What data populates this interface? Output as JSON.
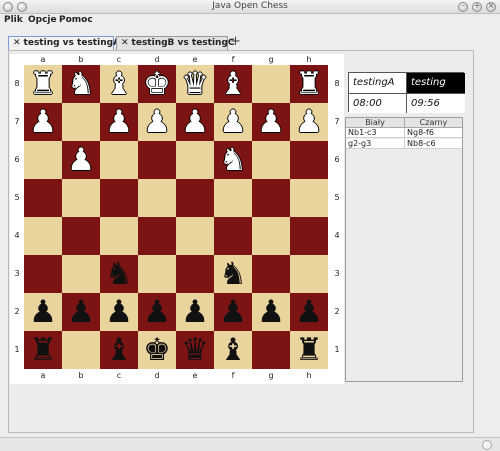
{
  "window": {
    "title": "Java Open Chess"
  },
  "menu": [
    "Plik",
    "Opcje",
    "Pomoc"
  ],
  "tabs": [
    {
      "label": "testing vs testingA",
      "active": true
    },
    {
      "label": "testingB vs testingC",
      "active": false
    }
  ],
  "new_tab_label": "+",
  "board": {
    "files": [
      "a",
      "b",
      "c",
      "d",
      "e",
      "f",
      "g",
      "h"
    ],
    "ranks": [
      "8",
      "7",
      "6",
      "5",
      "4",
      "3",
      "2",
      "1"
    ],
    "pieces": [
      [
        "wR",
        "wN",
        "wB",
        "wK",
        "wQ",
        "wB",
        "",
        "wR"
      ],
      [
        "wP",
        "",
        "wP",
        "wP",
        "wP",
        "wP",
        "wP",
        "wP"
      ],
      [
        "",
        "wP",
        "",
        "",
        "",
        "wN",
        "",
        ""
      ],
      [
        "",
        "",
        "",
        "",
        "",
        "",
        "",
        ""
      ],
      [
        "",
        "",
        "",
        "",
        "",
        "",
        "",
        ""
      ],
      [
        "",
        "",
        "bN",
        "",
        "",
        "bN",
        "",
        ""
      ],
      [
        "bP",
        "bP",
        "bP",
        "bP",
        "bP",
        "bP",
        "bP",
        "bP"
      ],
      [
        "bR",
        "",
        "bB",
        "bK",
        "bQ",
        "bB",
        "",
        "bR"
      ]
    ],
    "light_color": "#e9d49e",
    "dark_color": "#7c1414"
  },
  "clock": {
    "white_player": "testingA",
    "black_player": "testing",
    "white_time": "08:00",
    "black_time": "09:56"
  },
  "moves": {
    "headers": [
      "Biały",
      "Czarny"
    ],
    "rows": [
      [
        "Nb1-c3",
        "Ng8-f6"
      ],
      [
        "g2-g3",
        "Nb8-c6"
      ]
    ]
  }
}
